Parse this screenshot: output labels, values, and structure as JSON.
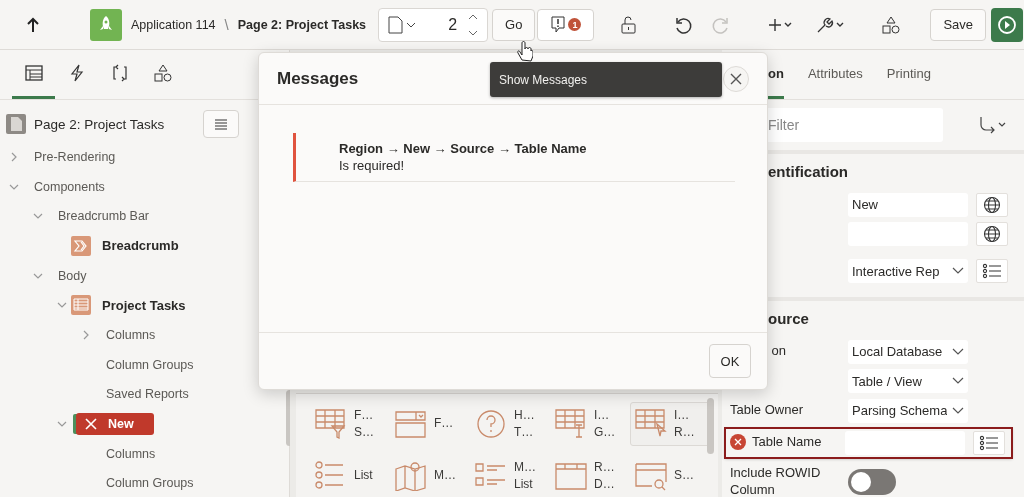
{
  "toolbar": {
    "app": "Application 114",
    "separator": "\\",
    "page": "Page 2: Project Tasks",
    "page_number": "2",
    "go": "Go",
    "messages_count": "1",
    "redo_disabled": true,
    "save": "Save"
  },
  "left_tabs": [
    {
      "kind": "tree",
      "selected": true
    },
    {
      "kind": "bolt",
      "selected": false
    },
    {
      "kind": "cycle",
      "selected": false
    },
    {
      "kind": "shapes",
      "selected": false
    }
  ],
  "tree": {
    "root": "Page 2: Project Tasks",
    "items": [
      {
        "label": "Pre-Rendering",
        "expanded": false,
        "selected": false
      },
      {
        "label": "Components",
        "expanded": true,
        "selected": false,
        "children": [
          {
            "label": "Breadcrumb Bar",
            "expanded": true,
            "selected": false,
            "children": [
              {
                "label": "Breadcrumb",
                "kind": "breadcrumb",
                "selected": false
              }
            ]
          },
          {
            "label": "Body",
            "expanded": true,
            "selected": false,
            "children": [
              {
                "label": "Project Tasks",
                "kind": "report",
                "expanded": true,
                "selected": false,
                "children": [
                  {
                    "label": "Columns",
                    "expanded": false,
                    "selected": false
                  },
                  {
                    "label": "Column Groups",
                    "selected": false
                  },
                  {
                    "label": "Saved Reports",
                    "selected": false
                  }
                ]
              },
              {
                "label": "New",
                "kind": "error",
                "expanded": true,
                "selected": true,
                "children": [
                  {
                    "label": "Columns",
                    "selected": false
                  },
                  {
                    "label": "Column Groups",
                    "selected": false
                  }
                ]
              }
            ]
          }
        ]
      }
    ]
  },
  "gallery": {
    "items": [
      {
        "kind": "grid-filter",
        "lines": [
          "F…",
          "S…"
        ],
        "selected": false
      },
      {
        "kind": "form",
        "lines": [
          "F…"
        ],
        "selected": false
      },
      {
        "kind": "help",
        "lines": [
          "H…",
          "T…"
        ],
        "selected": false
      },
      {
        "kind": "grid-edit",
        "lines": [
          "I…",
          "G…"
        ],
        "selected": false
      },
      {
        "kind": "grid-pointer",
        "lines": [
          "I…",
          "R…"
        ],
        "selected": true
      },
      {
        "kind": "list",
        "lines": [
          "List"
        ],
        "selected": false
      },
      {
        "kind": "map",
        "lines": [
          "M…"
        ],
        "selected": false
      },
      {
        "kind": "checklist",
        "lines": [
          "M…",
          "List"
        ],
        "selected": false
      },
      {
        "kind": "window",
        "lines": [
          "R…",
          "D…"
        ],
        "selected": false
      },
      {
        "kind": "search",
        "lines": [
          "S…"
        ],
        "selected": false
      }
    ]
  },
  "properties": {
    "tabs": [
      {
        "label": "on",
        "selected": true
      },
      {
        "label": "Attributes",
        "selected": false
      },
      {
        "label": "Printing",
        "selected": false
      }
    ],
    "filter": {
      "placeholder": "Filter"
    },
    "sections": [
      {
        "title": "entification",
        "rows": [
          {
            "kind": "text",
            "value": "New",
            "button": {
              "kind": "globe"
            }
          },
          {
            "kind": "text",
            "button": {
              "kind": "globe"
            }
          },
          {
            "kind": "select",
            "value": "Interactive Rep",
            "button": {
              "kind": "list"
            }
          }
        ]
      },
      {
        "title": "ource",
        "rows": [
          {
            "kind": "select",
            "label": "on",
            "cut_start": true,
            "value": "Local Database"
          },
          {
            "kind": "select",
            "value": "Table / View"
          },
          {
            "kind": "select",
            "label": "Table Owner",
            "value": "Parsing Schema"
          },
          {
            "kind": "text",
            "label": "Table Name",
            "error": true,
            "button": {
              "kind": "list"
            }
          },
          {
            "kind": "switch",
            "label": "Include ROWID Column",
            "on": false
          }
        ]
      }
    ]
  },
  "dialog": {
    "title": "Messages",
    "message_path": "Region → New → Source → Table Name",
    "message_text": "Is required!",
    "ok": "OK"
  },
  "tooltip": "Show Messages"
}
